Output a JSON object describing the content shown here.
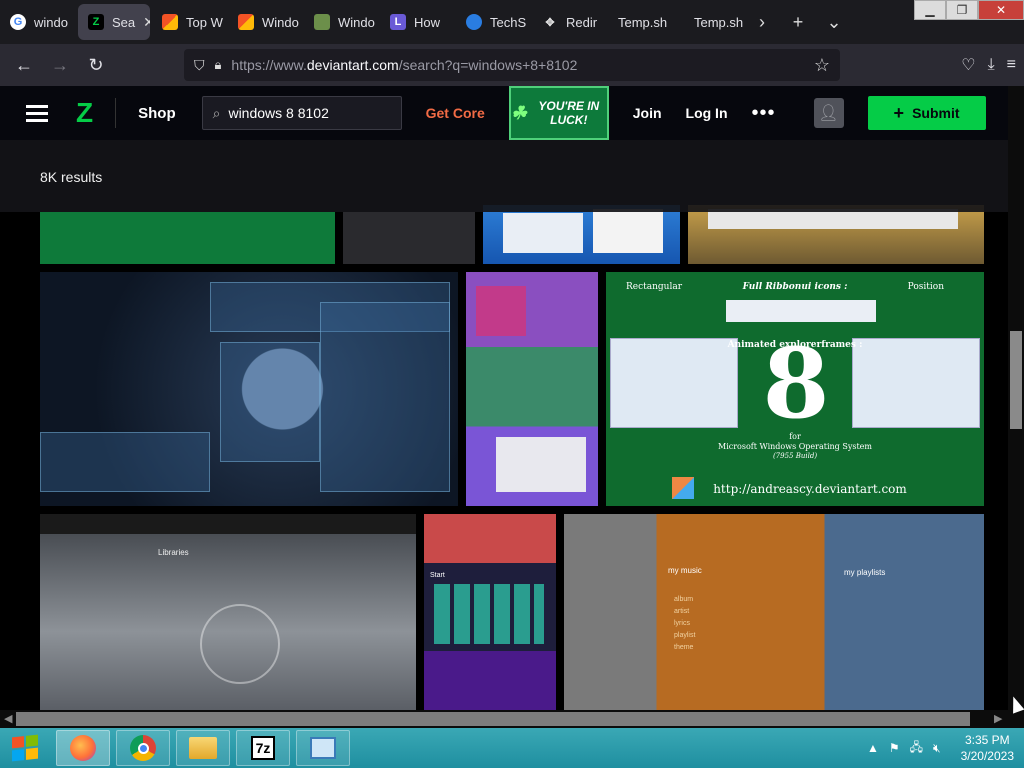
{
  "browser": {
    "tabs": [
      {
        "label": "windo",
        "icon": "google-icon",
        "active": false
      },
      {
        "label": "Sea",
        "icon": "deviantart-icon",
        "active": true
      },
      {
        "label": "Top W",
        "icon": "windows-icon",
        "active": false
      },
      {
        "label": "Windo",
        "icon": "windows-icon",
        "active": false
      },
      {
        "label": "Windo",
        "icon": "photo-icon",
        "active": false
      },
      {
        "label": "How",
        "icon": "letter-l-icon",
        "active": false
      },
      {
        "label": "TechS",
        "icon": "techspot-icon",
        "active": false
      },
      {
        "label": "Redir",
        "icon": "redirect-icon",
        "active": false
      },
      {
        "label": "Temp.sh",
        "icon": "",
        "active": false
      },
      {
        "label": "Temp.sh",
        "icon": "",
        "active": false
      }
    ],
    "url": "https://www.deviantart.com/search?q=windows+8+8102",
    "url_host": "https://www.",
    "url_domain": "deviantart.com",
    "url_path": "/search?q=windows+8+8102"
  },
  "site": {
    "shop": "Shop",
    "search_value": "windows 8 8102",
    "get_core": "Get Core",
    "luck_banner": "YOU'RE IN LUCK!",
    "join": "Join",
    "login": "Log In",
    "submit": "Submit",
    "results_count": "8K results",
    "accent": "#05cc47"
  },
  "thumbnails": {
    "eight": {
      "title_left": "Rectangular",
      "title_center": "Full Ribbonui icons :",
      "title_right": "Position",
      "label": "Animated explorerframes :",
      "digit": "8",
      "for": "for",
      "os": "Microsoft Windows Operating System",
      "build": "(7955 Build)",
      "url": "http://andreascy.deviantart.com"
    },
    "music": {
      "my_music": "my music",
      "menu": [
        "album",
        "artist",
        "lyrics",
        "playlist",
        "theme"
      ],
      "my_playlists": "my playlists"
    },
    "libraries": {
      "title": "Libraries"
    },
    "metro": {
      "start": "Start"
    }
  },
  "taskbar": {
    "apps": [
      "firefox-icon",
      "chrome-icon",
      "file-explorer-icon",
      "7zip-icon",
      "control-panel-icon"
    ],
    "seven_zip": "7z",
    "time": "3:35 PM",
    "date": "3/20/2023"
  }
}
